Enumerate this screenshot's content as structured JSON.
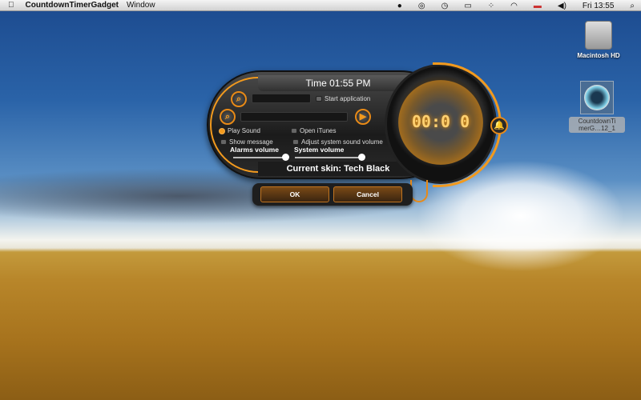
{
  "menubar": {
    "apple": "",
    "app_name": "CountdownTimerGadget",
    "menu": "Window",
    "clock": "Fri 13:55"
  },
  "desktop": {
    "icons": [
      {
        "label": "Macintosh HD"
      },
      {
        "label": "CountdownTi merG…12_1"
      }
    ]
  },
  "widget": {
    "title": "Time 01:55 PM",
    "start_application": "Start application",
    "play_sound": "Play Sound",
    "open_itunes": "Open iTunes",
    "show_message": "Show message",
    "adjust_volume": "Adjust system sound volume",
    "alarms_volume_label": "Alarms volume",
    "system_volume_label": "System volume",
    "alarms_volume": 1.0,
    "system_volume": 1.0,
    "timer": "00:0 0",
    "current_skin": "Current skin: Tech Black",
    "ok": "OK",
    "cancel": "Cancel",
    "accent": "#f29a1e"
  }
}
